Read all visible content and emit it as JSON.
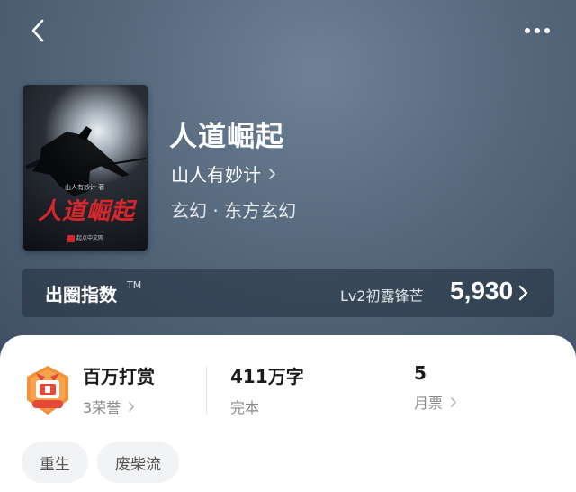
{
  "book": {
    "title": "人道崛起",
    "author": "山人有妙计",
    "genre": "玄幻 · 东方玄幻"
  },
  "cover": {
    "author_text": "山人有妙计 著",
    "title_text": "人道崛起",
    "publisher": "起点中文网"
  },
  "popularity": {
    "label": "出圈指数",
    "tm": "TM",
    "level": "Lv2初露锋芒",
    "score": "5,930"
  },
  "stats": {
    "reward": {
      "main": "百万打赏",
      "sub": "3荣誉"
    },
    "words": {
      "main": "411万字",
      "sub": "完本"
    },
    "tickets": {
      "main": "5",
      "sub": "月票"
    }
  },
  "tags": [
    "重生",
    "废柴流"
  ],
  "icons": {
    "back": "chevron-left-icon",
    "more": "more-dots-icon",
    "badge": "gift-badge-icon"
  },
  "colors": {
    "hero_bg": "#55687c",
    "cover_title_red": "#d8262c",
    "badge_orange": "#f2913a"
  }
}
